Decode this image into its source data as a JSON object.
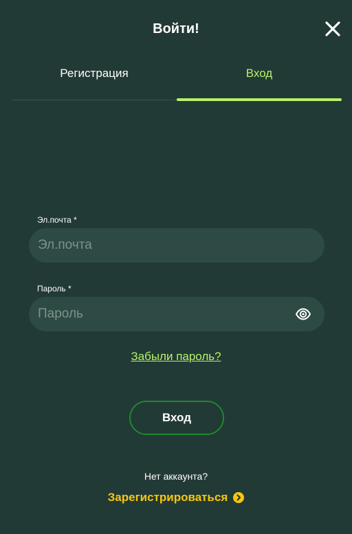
{
  "modal": {
    "title": "Войти!",
    "close_icon": "close-icon"
  },
  "tabs": [
    {
      "label": "Регистрация",
      "active": false
    },
    {
      "label": "Вход",
      "active": true
    }
  ],
  "form": {
    "email": {
      "label": "Эл.почта *",
      "placeholder": "Эл.почта",
      "value": ""
    },
    "password": {
      "label": "Пароль *",
      "placeholder": "Пароль",
      "value": "",
      "toggle_icon": "eye-icon"
    },
    "forgot_label": "Забыли пароль?",
    "submit_label": "Вход"
  },
  "footer": {
    "no_account_text": "Нет аккаунта?",
    "register_label": "Зарегистрироваться",
    "register_icon": "chevron-right-circle-icon"
  },
  "colors": {
    "background": "#223a35",
    "field_background": "#2e4a44",
    "accent_green": "#b6f36a",
    "button_border": "#1b8a2d",
    "link_yellow": "#f6c711"
  }
}
